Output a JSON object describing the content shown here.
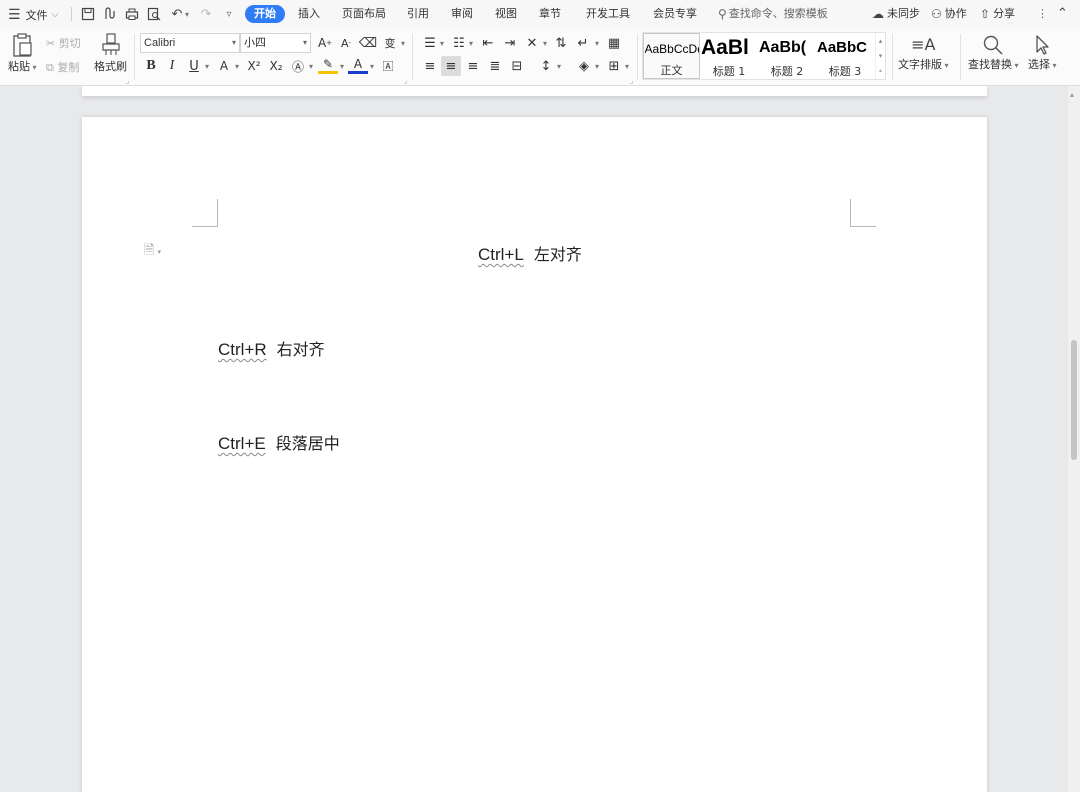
{
  "menubar": {
    "file_label": "文件",
    "tabs": [
      "开始",
      "插入",
      "页面布局",
      "引用",
      "审阅",
      "视图",
      "章节",
      "开发工具",
      "会员专享"
    ],
    "active_tab": "开始",
    "search_placeholder": "查找命令、搜索模板",
    "sync_label": "未同步",
    "collab_label": "协作",
    "share_label": "分享"
  },
  "ribbon": {
    "paste_label": "粘贴",
    "cut_label": "剪切",
    "copy_label": "复制",
    "format_painter_label": "格式刷",
    "font_name": "Calibri",
    "font_size": "小四",
    "styles": [
      {
        "sample": "AaBbCcDd",
        "label": "正文"
      },
      {
        "sample": "AaBl",
        "label": "标题 1"
      },
      {
        "sample": "AaBb(",
        "label": "标题 2"
      },
      {
        "sample": "AaBbC",
        "label": "标题 3"
      }
    ],
    "text_layout_label": "文字排版",
    "find_replace_label": "查找替换",
    "select_label": "选择"
  },
  "document": {
    "lines": [
      {
        "shortcut": "Ctrl+L",
        "text": "左对齐",
        "alignment": "center"
      },
      {
        "shortcut": "Ctrl+R",
        "text": "右对齐",
        "alignment": "left"
      },
      {
        "shortcut": "Ctrl+E",
        "text": "段落居中",
        "alignment": "left"
      }
    ]
  },
  "colors": {
    "accent": "#2f7cf6",
    "workspace_bg": "#e8e9eb",
    "page_bg": "#ffffff"
  }
}
